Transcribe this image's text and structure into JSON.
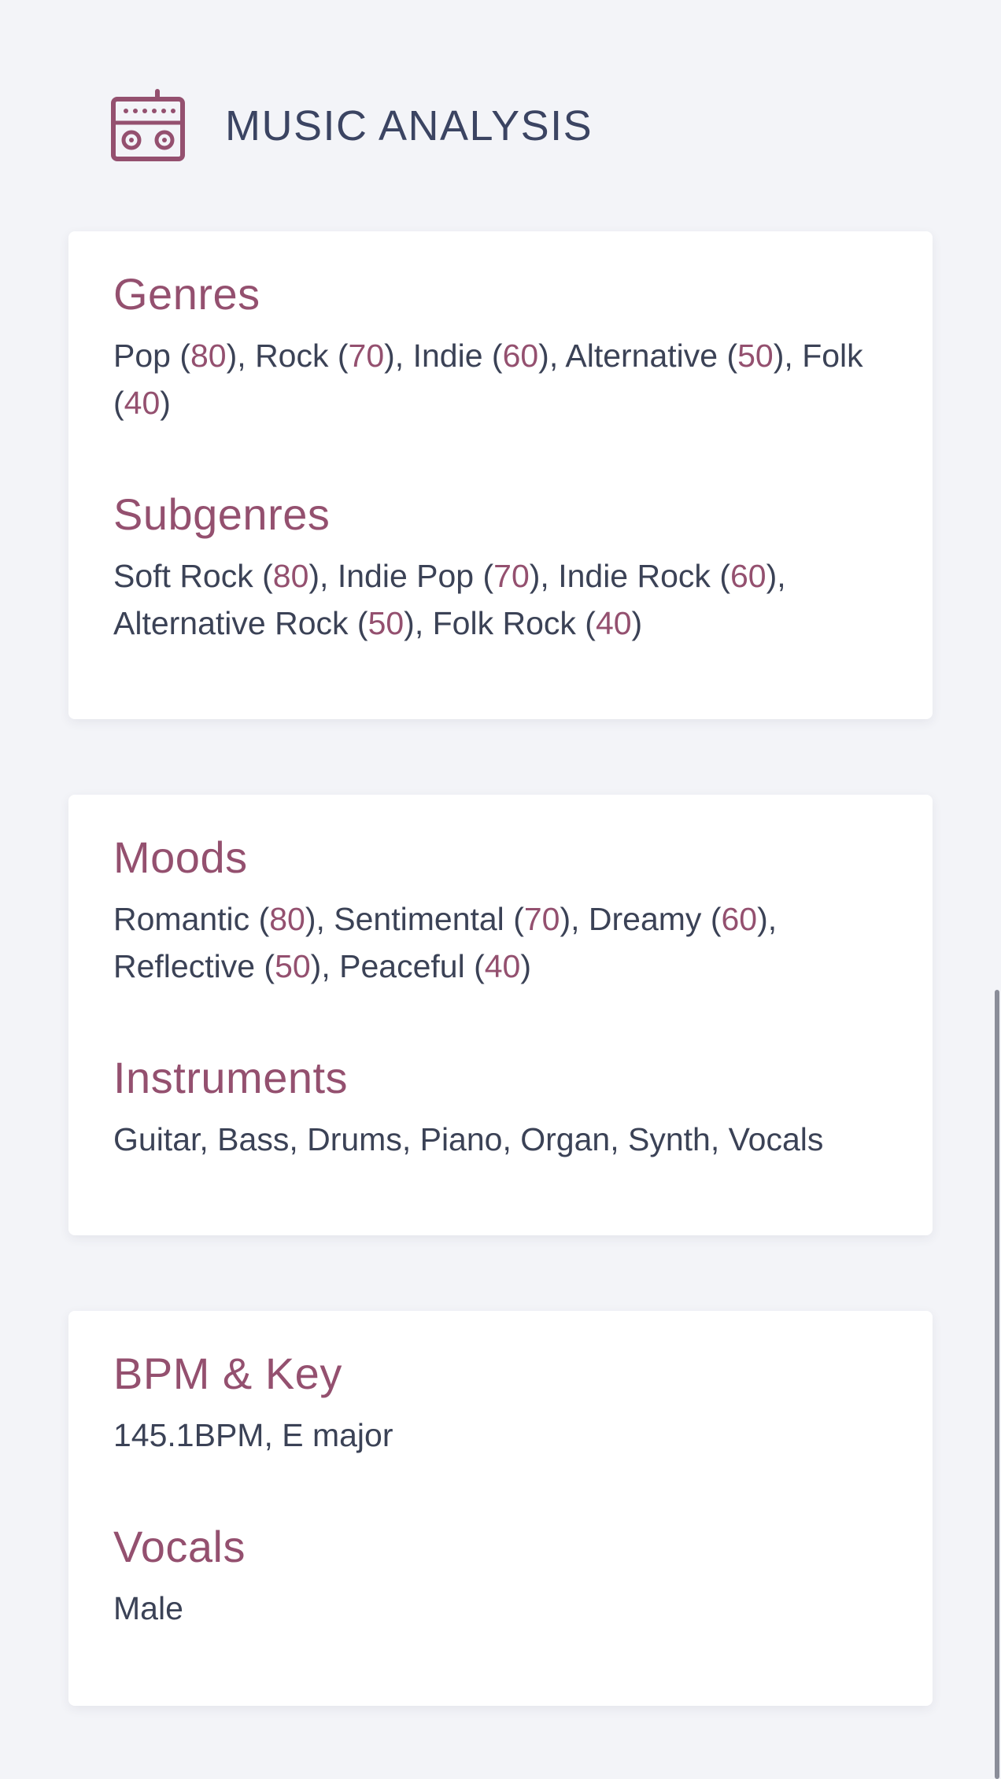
{
  "header": {
    "icon": "radio-icon",
    "title": "MUSIC ANALYSIS"
  },
  "colors": {
    "accent": "#94506f",
    "text": "#3b4256",
    "background": "#f3f4f8",
    "card": "#ffffff"
  },
  "cards": [
    {
      "sections": [
        {
          "title": "Genres",
          "items": [
            {
              "name": "Pop",
              "score": "80"
            },
            {
              "name": "Rock",
              "score": "70"
            },
            {
              "name": "Indie",
              "score": "60"
            },
            {
              "name": "Alternative",
              "score": "50"
            },
            {
              "name": "Folk",
              "score": "40"
            }
          ]
        },
        {
          "title": "Subgenres",
          "items": [
            {
              "name": "Soft Rock",
              "score": "80"
            },
            {
              "name": "Indie Pop",
              "score": "70"
            },
            {
              "name": "Indie Rock",
              "score": "60"
            },
            {
              "name": "Alternative Rock",
              "score": "50"
            },
            {
              "name": "Folk Rock",
              "score": "40"
            }
          ]
        }
      ]
    },
    {
      "sections": [
        {
          "title": "Moods",
          "items": [
            {
              "name": "Romantic",
              "score": "80"
            },
            {
              "name": "Sentimental",
              "score": "70"
            },
            {
              "name": "Dreamy",
              "score": "60"
            },
            {
              "name": "Reflective",
              "score": "50"
            },
            {
              "name": "Peaceful",
              "score": "40"
            }
          ]
        },
        {
          "title": "Instruments",
          "text": "Guitar, Bass, Drums, Piano, Organ, Synth, Vocals"
        }
      ]
    },
    {
      "sections": [
        {
          "title": "BPM & Key",
          "text": "145.1BPM, E major"
        },
        {
          "title": "Vocals",
          "text": "Male"
        }
      ]
    }
  ]
}
